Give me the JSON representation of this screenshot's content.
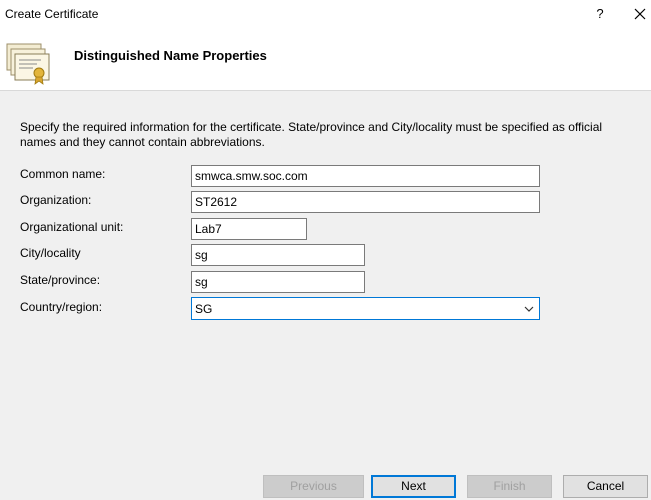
{
  "window": {
    "title": "Create Certificate",
    "help_label": "?"
  },
  "header": {
    "title": "Distinguished Name Properties"
  },
  "description": "Specify the required information for the certificate. State/province and City/locality must be specified as official names and they cannot contain abbreviations.",
  "fields": {
    "common_name": {
      "label": "Common name:",
      "value": "smwca.smw.soc.com"
    },
    "organization": {
      "label": "Organization:",
      "value": "ST2612"
    },
    "organizational_unit": {
      "label": "Organizational unit:",
      "value": "Lab7"
    },
    "city": {
      "label": "City/locality",
      "value": "sg"
    },
    "state": {
      "label": "State/province:",
      "value": "sg"
    },
    "country": {
      "label": "Country/region:",
      "value": "SG"
    }
  },
  "buttons": {
    "previous": "Previous",
    "next": "Next",
    "finish": "Finish",
    "cancel": "Cancel"
  },
  "colors": {
    "focus_border": "#0078d7",
    "disabled_text": "#a0a0a0"
  }
}
